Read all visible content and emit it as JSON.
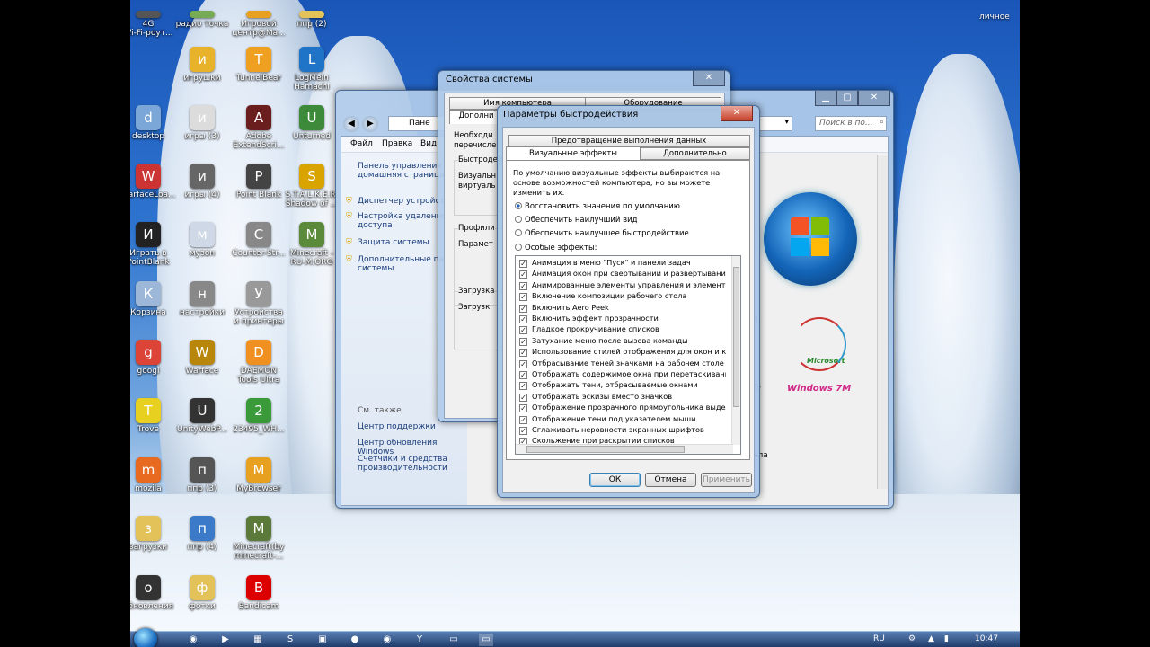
{
  "desktop": {
    "corner_label": "личное",
    "icons": [
      {
        "label": "4G\nWi-Fi-роут...",
        "icon": "router-icon",
        "color": "#555"
      },
      {
        "label": "радио точка",
        "icon": "radio-icon",
        "color": "#7a5"
      },
      {
        "label": "Игровой\nцентр@Ma...",
        "icon": "game-center-icon",
        "color": "#e8a020"
      },
      {
        "label": "ппр (2)",
        "icon": "folder-icon",
        "color": "#e3c25a"
      },
      {
        "label": "игрушки",
        "icon": "toys-icon",
        "color": "#e8b22a"
      },
      {
        "label": "TunnelBear",
        "icon": "tunnelbear-icon",
        "color": "#f0a020"
      },
      {
        "label": "LogMeIn\nHamachi",
        "icon": "hamachi-icon",
        "color": "#1f74c8"
      },
      {
        "label": "desktop",
        "icon": "desktop-icon",
        "color": "#7ba6d8"
      },
      {
        "label": "игры (3)",
        "icon": "games-folder-icon",
        "color": "#dcdcdc"
      },
      {
        "label": "Adobe\nExtendScri...",
        "icon": "adobe-icon",
        "color": "#6b1e1e"
      },
      {
        "label": "Unturned",
        "icon": "unturned-icon",
        "color": "#3c8a3a"
      },
      {
        "label": "WarfaceLoa...",
        "icon": "warface-loader-icon",
        "color": "#c33"
      },
      {
        "label": "игры (4)",
        "icon": "star-icon",
        "color": "#666"
      },
      {
        "label": "Point Blank",
        "icon": "point-blank-icon",
        "color": "#444"
      },
      {
        "label": "S.T.A.L.K.E.R.\nShadow of ...",
        "icon": "stalker-icon",
        "color": "#d9a400"
      },
      {
        "label": "Играть в\nPointBlank",
        "icon": "pointblank-play-icon",
        "color": "#222"
      },
      {
        "label": "музон",
        "icon": "music-icon",
        "color": "#cfd8e6"
      },
      {
        "label": "Counter-Str...",
        "icon": "counter-strike-icon",
        "color": "#888"
      },
      {
        "label": "Minecraft -\nRU-M.ORG",
        "icon": "minecraft-icon",
        "color": "#5b8a3a"
      },
      {
        "label": "Корзина",
        "icon": "recycle-bin-icon",
        "color": "#9cb7d8"
      },
      {
        "label": "настройки",
        "icon": "settings-icon",
        "color": "#888"
      },
      {
        "label": "Устройства\nи принтеры",
        "icon": "printer-icon",
        "color": "#999"
      },
      {
        "label": "googl",
        "icon": "chrome-icon",
        "color": "#db4437"
      },
      {
        "label": "Warface",
        "icon": "warface-icon",
        "color": "#b8860b"
      },
      {
        "label": "DAEMON\nTools Ultra",
        "icon": "daemon-tools-icon",
        "color": "#f09020"
      },
      {
        "label": "Trove",
        "icon": "trove-icon",
        "color": "#e8d020"
      },
      {
        "label": "UnityWebP...",
        "icon": "unity-icon",
        "color": "#333"
      },
      {
        "label": "23495_WH...",
        "icon": "utorrent-icon",
        "color": "#3a9a3a"
      },
      {
        "label": "mozila",
        "icon": "firefox-icon",
        "color": "#e86a20"
      },
      {
        "label": "ппр (3)",
        "icon": "folder2-icon",
        "color": "#555"
      },
      {
        "label": "MyBrowser",
        "icon": "browser-icon",
        "color": "#e8a020"
      },
      {
        "label": "загрузки",
        "icon": "downloads-folder-icon",
        "color": "#e3c25a"
      },
      {
        "label": "ппр (4)",
        "icon": "folder3-icon",
        "color": "#3a7ac8"
      },
      {
        "label": "Minecraft(by\nminecraft-...",
        "icon": "minecraft2-icon",
        "color": "#5b7a3a"
      },
      {
        "label": "обновления",
        "icon": "updates-icon",
        "color": "#333"
      },
      {
        "label": "фотки",
        "icon": "photos-folder-icon",
        "color": "#e3c25a"
      },
      {
        "label": "Bandicam",
        "icon": "bandicam-icon",
        "color": "#d00"
      }
    ]
  },
  "control_panel": {
    "search_placeholder": "Поиск в по...",
    "breadcrumb": "Пане",
    "menu": [
      "Файл",
      "Правка",
      "Вид"
    ],
    "links": [
      "Панель управления -\nдомашняя страница",
      "Диспетчер устройств",
      "Настройка удаленного\nдоступа",
      "Защита системы",
      "Дополнительные па\nсистемы"
    ],
    "see_also": "См. также",
    "see_also_links": [
      "Центр поддержки",
      "Центр обновления Windows",
      "Счетчики и средства\nпроизводительности"
    ],
    "right_fragments": [
      "ft",
      "@",
      "ала"
    ],
    "oem_text": "Windows 7M",
    "oem_badge": "Microsoft"
  },
  "system_props": {
    "title": "Свойства системы",
    "close": "✕",
    "tabs_top": [
      "Имя компьютера",
      "Оборудование"
    ],
    "tab_active": "Дополни",
    "text_lines": [
      "Необходи",
      "перечисле"
    ],
    "group1": "Быстродей",
    "group1_lines": [
      "Визуальн",
      "виртуаль"
    ],
    "group2": "Профили",
    "group2_line": "Парамет",
    "group3": "Загрузка",
    "group3_line": "Загрузк"
  },
  "perf": {
    "title": "Параметры быстродействия",
    "close": "✕",
    "tab_row_back": "Предотвращение выполнения данных",
    "tabs": [
      "Визуальные эффекты",
      "Дополнительно"
    ],
    "description": "По умолчанию визуальные эффекты выбираются на основе возможностей компьютера, но вы можете изменить их.",
    "radios": [
      {
        "label": "Восстановить значения по умолчанию",
        "selected": true
      },
      {
        "label": "Обеспечить наилучший вид",
        "selected": false
      },
      {
        "label": "Обеспечить наилучшее быстродействие",
        "selected": false
      },
      {
        "label": "Особые эффекты:",
        "selected": false
      }
    ],
    "checks": [
      "Анимация в меню \"Пуск\" и панели задач",
      "Анимация окон при свертывании и развертывании",
      "Анимированные элементы управления и элементы вну",
      "Включение композиции рабочего стола",
      "Включить Aero Peek",
      "Включить эффект прозрачности",
      "Гладкое прокручивание списков",
      "Затухание меню после вызова команды",
      "Использование стилей отображения для окон и кнопо",
      "Отбрасывание теней значками на рабочем столе",
      "Отображать содержимое окна при перетаскивании",
      "Отображать тени, отбрасываемые окнами",
      "Отображать эскизы вместо значков",
      "Отображение прозрачного прямоугольника выделени",
      "Отображение тени под указателем мыши",
      "Сглаживать неровности экранных шрифтов",
      "Скольжение при раскрытии списков"
    ],
    "ok": "ОК",
    "cancel": "Отмена",
    "apply": "Применить"
  },
  "taskbar": {
    "lang": "RU",
    "time": "10:47"
  }
}
